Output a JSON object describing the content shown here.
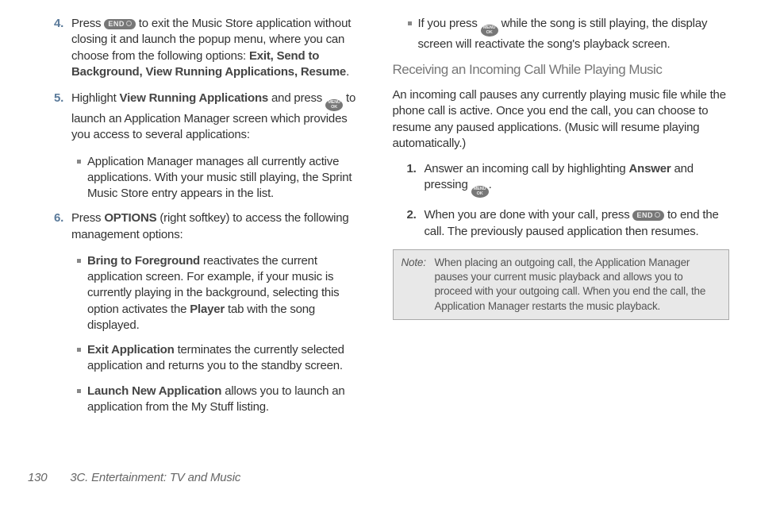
{
  "left": {
    "item4": {
      "num": "4.",
      "t1": "Press ",
      "t2": " to exit the Music Store application without closing it and launch the popup menu, where you can choose from the following options: ",
      "opts": "Exit, Send to Background, View Running Applications, Resume",
      "period": "."
    },
    "item5": {
      "num": "5.",
      "t1": "Highlight ",
      "b1": "View Running Applications",
      "t2": "  and press ",
      "t3": " to launch an Application Manager screen which provides you access to several applications:"
    },
    "sub5a": "Application Manager manages all currently active applications. With your music still playing, the Sprint Music Store entry appears in the list.",
    "item6": {
      "num": "6.",
      "t1": "Press ",
      "b1": "OPTIONS",
      "t2": " (right softkey) to access the following management options:"
    },
    "sub6a": {
      "b": "Bring to Foreground",
      "t1": " reactivates the current application screen. For example, if your music is currently playing in the background, selecting this option activates the ",
      "b2": "Player",
      "t2": " tab with the song displayed."
    },
    "sub6b": {
      "b": "Exit Application",
      "t": " terminates the currently selected application and returns you to the standby screen."
    },
    "sub6c": {
      "b": "Launch New Application",
      "t": " allows you to launch an application from the My Stuff listing."
    }
  },
  "right": {
    "subtop": {
      "t1": "If you press ",
      "t2": " while the song is still playing, the display screen will reactivate the song's playback screen."
    },
    "heading": "Receiving an Incoming Call While Playing Music",
    "para": "An incoming call pauses any currently playing music file while the phone call is active. Once you end the call, you can choose to resume any paused applications. (Music will resume playing automatically.)",
    "r1": {
      "num": "1.",
      "t1": "Answer an incoming call by highlighting ",
      "b": "Answer",
      "t2": " and pressing ",
      "t3": "."
    },
    "r2": {
      "num": "2.",
      "t1": "When you are done with your call, press ",
      "t2": " to end the call. The previously paused application then resumes."
    },
    "note": {
      "label": "Note:",
      "text": "When placing an outgoing call, the Application Manager pauses your current music playback and allows you to proceed with your outgoing call. When you end the call, the Application Manager restarts the music playback."
    }
  },
  "keys": {
    "end": "END",
    "ok_top": "MENU",
    "ok_bot": "OK"
  },
  "footer": {
    "page": "130",
    "section": "3C. Entertainment: TV and Music"
  }
}
